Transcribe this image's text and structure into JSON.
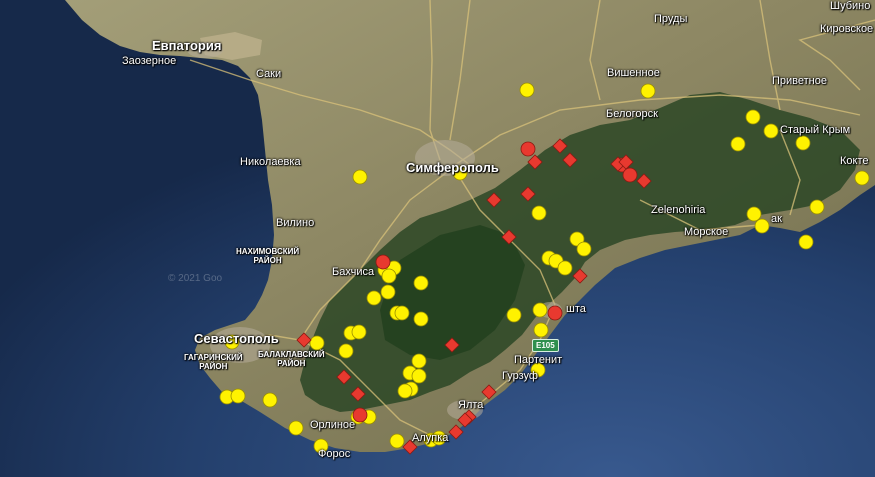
{
  "map": {
    "labels": {
      "yevpatoria": "Евпатория",
      "zaozernoe": "Заозерное",
      "saki": "Саки",
      "nikolaevka": "Николаевка",
      "vilino": "Вилино",
      "nakhimovsky": "НАХИМОВСКИЙ\nРАЙОН",
      "bakhchisaray": "Бахчиса",
      "sevastopol": "Севастополь",
      "gagarinsky": "ГАГАРИНСКИЙ\nРАЙОН",
      "balaklavsky": "БАЛАКЛАВСКИЙ\nРАЙОН",
      "simferopol": "Симферополь",
      "prudy": "Пруды",
      "vishennoe": "Вишенное",
      "belogorsk": "Белогорск",
      "privetnoe": "Приветное",
      "stary_krym": "Старый Крым",
      "kirovskoe": "Кировское",
      "shubino": "Шубино",
      "zelenohiria": "Zelenohiria",
      "morskoe": "Морское",
      "sudak": "ак",
      "koktebel": "Кокте",
      "alushta": "шта",
      "partenit": "Партенит",
      "gurzuf": "Гурзуф",
      "yalta": "Ялта",
      "orlinoe": "Орлиное",
      "alupka": "Алупка",
      "foros": "Форос"
    },
    "road_badge": "E105",
    "attribution": "© 2021 Goo",
    "colors": {
      "yellow_marker": "#fff200",
      "red_marker": "#e8392f",
      "sea": "#1c3a6a",
      "land": "#8a8a62",
      "forest": "#2f4a2a"
    }
  }
}
